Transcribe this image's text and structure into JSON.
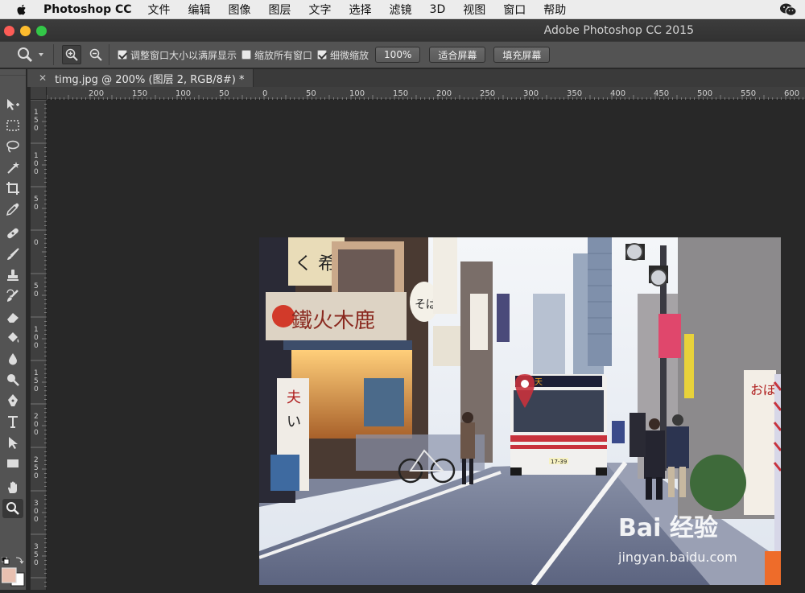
{
  "menubar": {
    "app_name": "Photoshop CC",
    "items": [
      "文件",
      "编辑",
      "图像",
      "图层",
      "文字",
      "选择",
      "滤镜",
      "3D",
      "视图",
      "窗口",
      "帮助"
    ]
  },
  "window": {
    "title": "Adobe Photoshop CC 2015"
  },
  "options": {
    "resize_windows_label": "调整窗口大小以满屏显示",
    "resize_windows_checked": true,
    "zoom_all_label": "缩放所有窗口",
    "zoom_all_checked": false,
    "scrubby_zoom_label": "细微缩放",
    "scrubby_zoom_checked": true,
    "btn_100": "100%",
    "btn_fit": "适合屏幕",
    "btn_fill": "填充屏幕"
  },
  "document": {
    "tab_title": "timg.jpg @ 200% (图层 2, RGB/8#) *"
  },
  "ruler": {
    "h_labels": [
      "200",
      "150",
      "100",
      "50",
      "0",
      "50",
      "100",
      "150",
      "200",
      "250",
      "300",
      "350",
      "400",
      "450",
      "500",
      "550",
      "600"
    ],
    "v_labels": [
      "150",
      "100",
      "50",
      "0",
      "50",
      "100",
      "150",
      "200",
      "250",
      "300",
      "350"
    ]
  },
  "photo": {
    "shop_sign": "鐵火木鹿",
    "bus_display": "天",
    "lantern_text": "そば",
    "right_banner": "おぼさんべい",
    "bus_plate": "17-39"
  },
  "watermark": {
    "brand": "Bai 经验",
    "url": "jingyan.baidu.com"
  },
  "colors": {
    "foreground": "#e8c0b0",
    "background": "#ffffff",
    "accent_blue": "#2a6fd6"
  }
}
